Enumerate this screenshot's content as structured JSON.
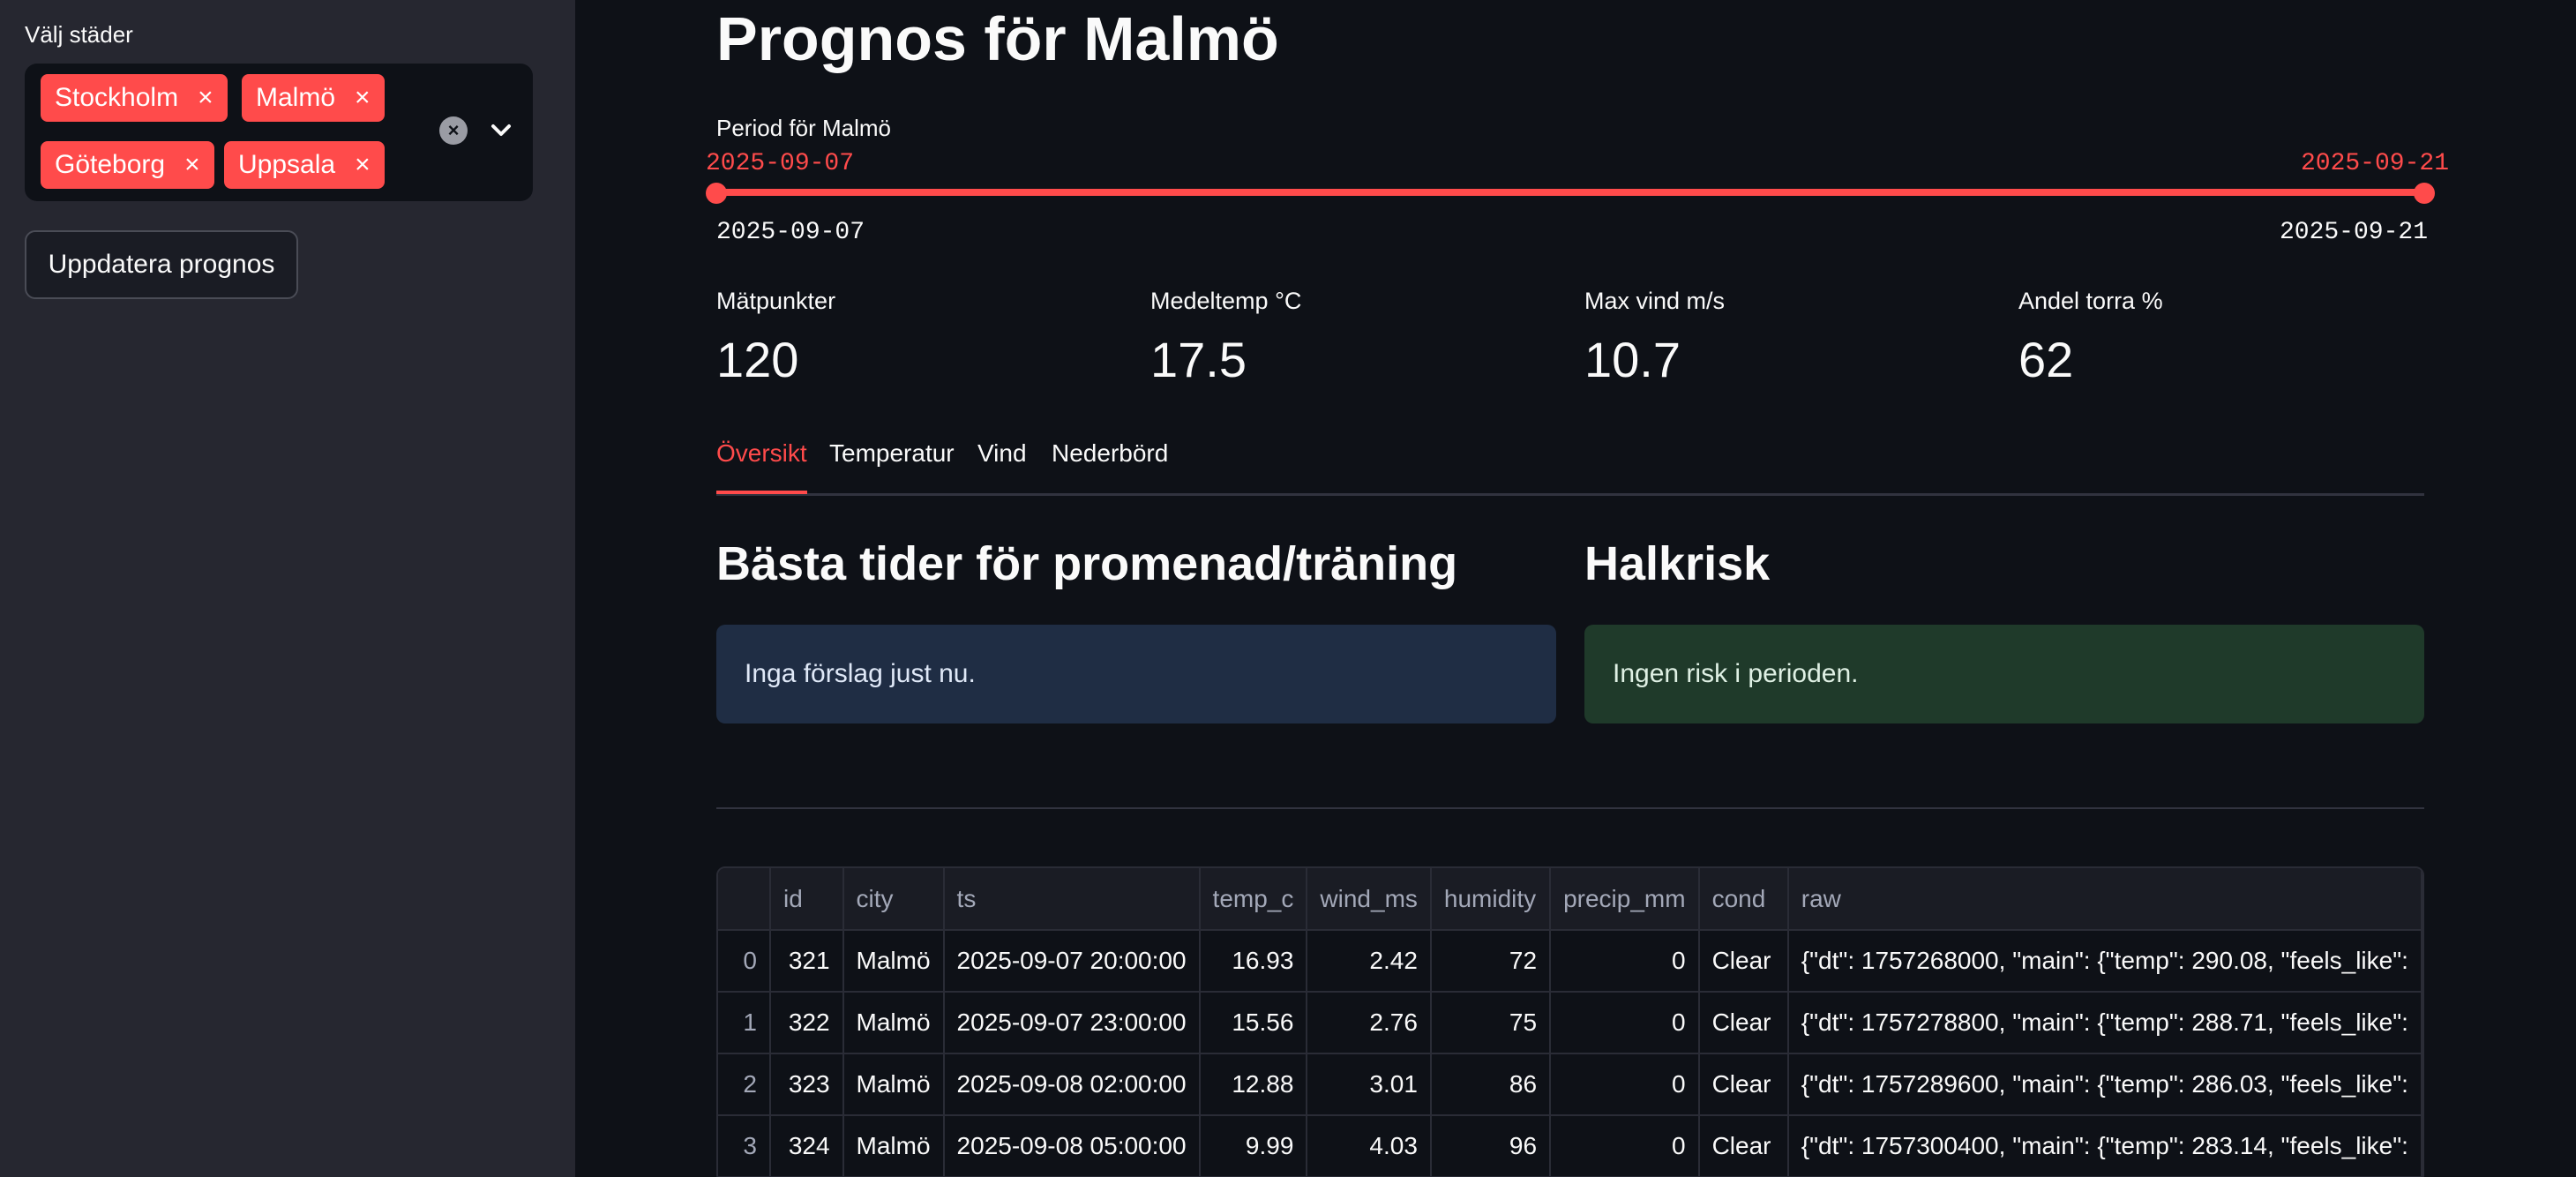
{
  "sidebar": {
    "label": "Välj städer",
    "selected": [
      "Stockholm",
      "Malmö",
      "Göteborg",
      "Uppsala"
    ],
    "remove_glyph": "×",
    "update_label": "Uppdatera prognos"
  },
  "main": {
    "title": "Prognos för Malmö",
    "slider": {
      "label": "Period för Malmö",
      "start": "2025-09-07",
      "end": "2025-09-21",
      "min": "2025-09-07",
      "max": "2025-09-21"
    },
    "metrics": [
      {
        "label": "Mätpunkter",
        "value": "120"
      },
      {
        "label": "Medeltemp °C",
        "value": "17.5"
      },
      {
        "label": "Max vind m/s",
        "value": "10.7"
      },
      {
        "label": "Andel torra %",
        "value": "62"
      }
    ],
    "tabs": [
      "Översikt",
      "Temperatur",
      "Vind",
      "Nederbörd"
    ],
    "active_tab": "Översikt",
    "sections": {
      "best_times_title": "Bästa tider för promenad/träning",
      "best_times_msg": "Inga förslag just nu.",
      "slip_title": "Halkrisk",
      "slip_msg": "Ingen risk i perioden."
    },
    "table": {
      "columns": [
        "",
        "id",
        "city",
        "ts",
        "temp_c",
        "wind_ms",
        "humidity",
        "precip_mm",
        "cond",
        "raw"
      ],
      "rows": [
        [
          "0",
          "321",
          "Malmö",
          "2025-09-07 20:00:00",
          "16.93",
          "2.42",
          "72",
          "0",
          "Clear",
          "{\"dt\": 1757268000, \"main\": {\"temp\": 290.08, \"feels_like\":"
        ],
        [
          "1",
          "322",
          "Malmö",
          "2025-09-07 23:00:00",
          "15.56",
          "2.76",
          "75",
          "0",
          "Clear",
          "{\"dt\": 1757278800, \"main\": {\"temp\": 288.71, \"feels_like\":"
        ],
        [
          "2",
          "323",
          "Malmö",
          "2025-09-08 02:00:00",
          "12.88",
          "3.01",
          "86",
          "0",
          "Clear",
          "{\"dt\": 1757289600, \"main\": {\"temp\": 286.03, \"feels_like\":"
        ],
        [
          "3",
          "324",
          "Malmö",
          "2025-09-08 05:00:00",
          "9.99",
          "4.03",
          "96",
          "0",
          "Clear",
          "{\"dt\": 1757300400, \"main\": {\"temp\": 283.14, \"feels_like\":"
        ]
      ]
    }
  },
  "colors": {
    "accent": "#ff4b4b",
    "background": "#0e1117",
    "sidebar": "#262730",
    "info": "#1f2d44",
    "success": "#1f3a2a"
  },
  "icons": {
    "chip_remove": "close-icon",
    "clear_all": "clear-icon",
    "dropdown": "chevron-down-icon"
  }
}
